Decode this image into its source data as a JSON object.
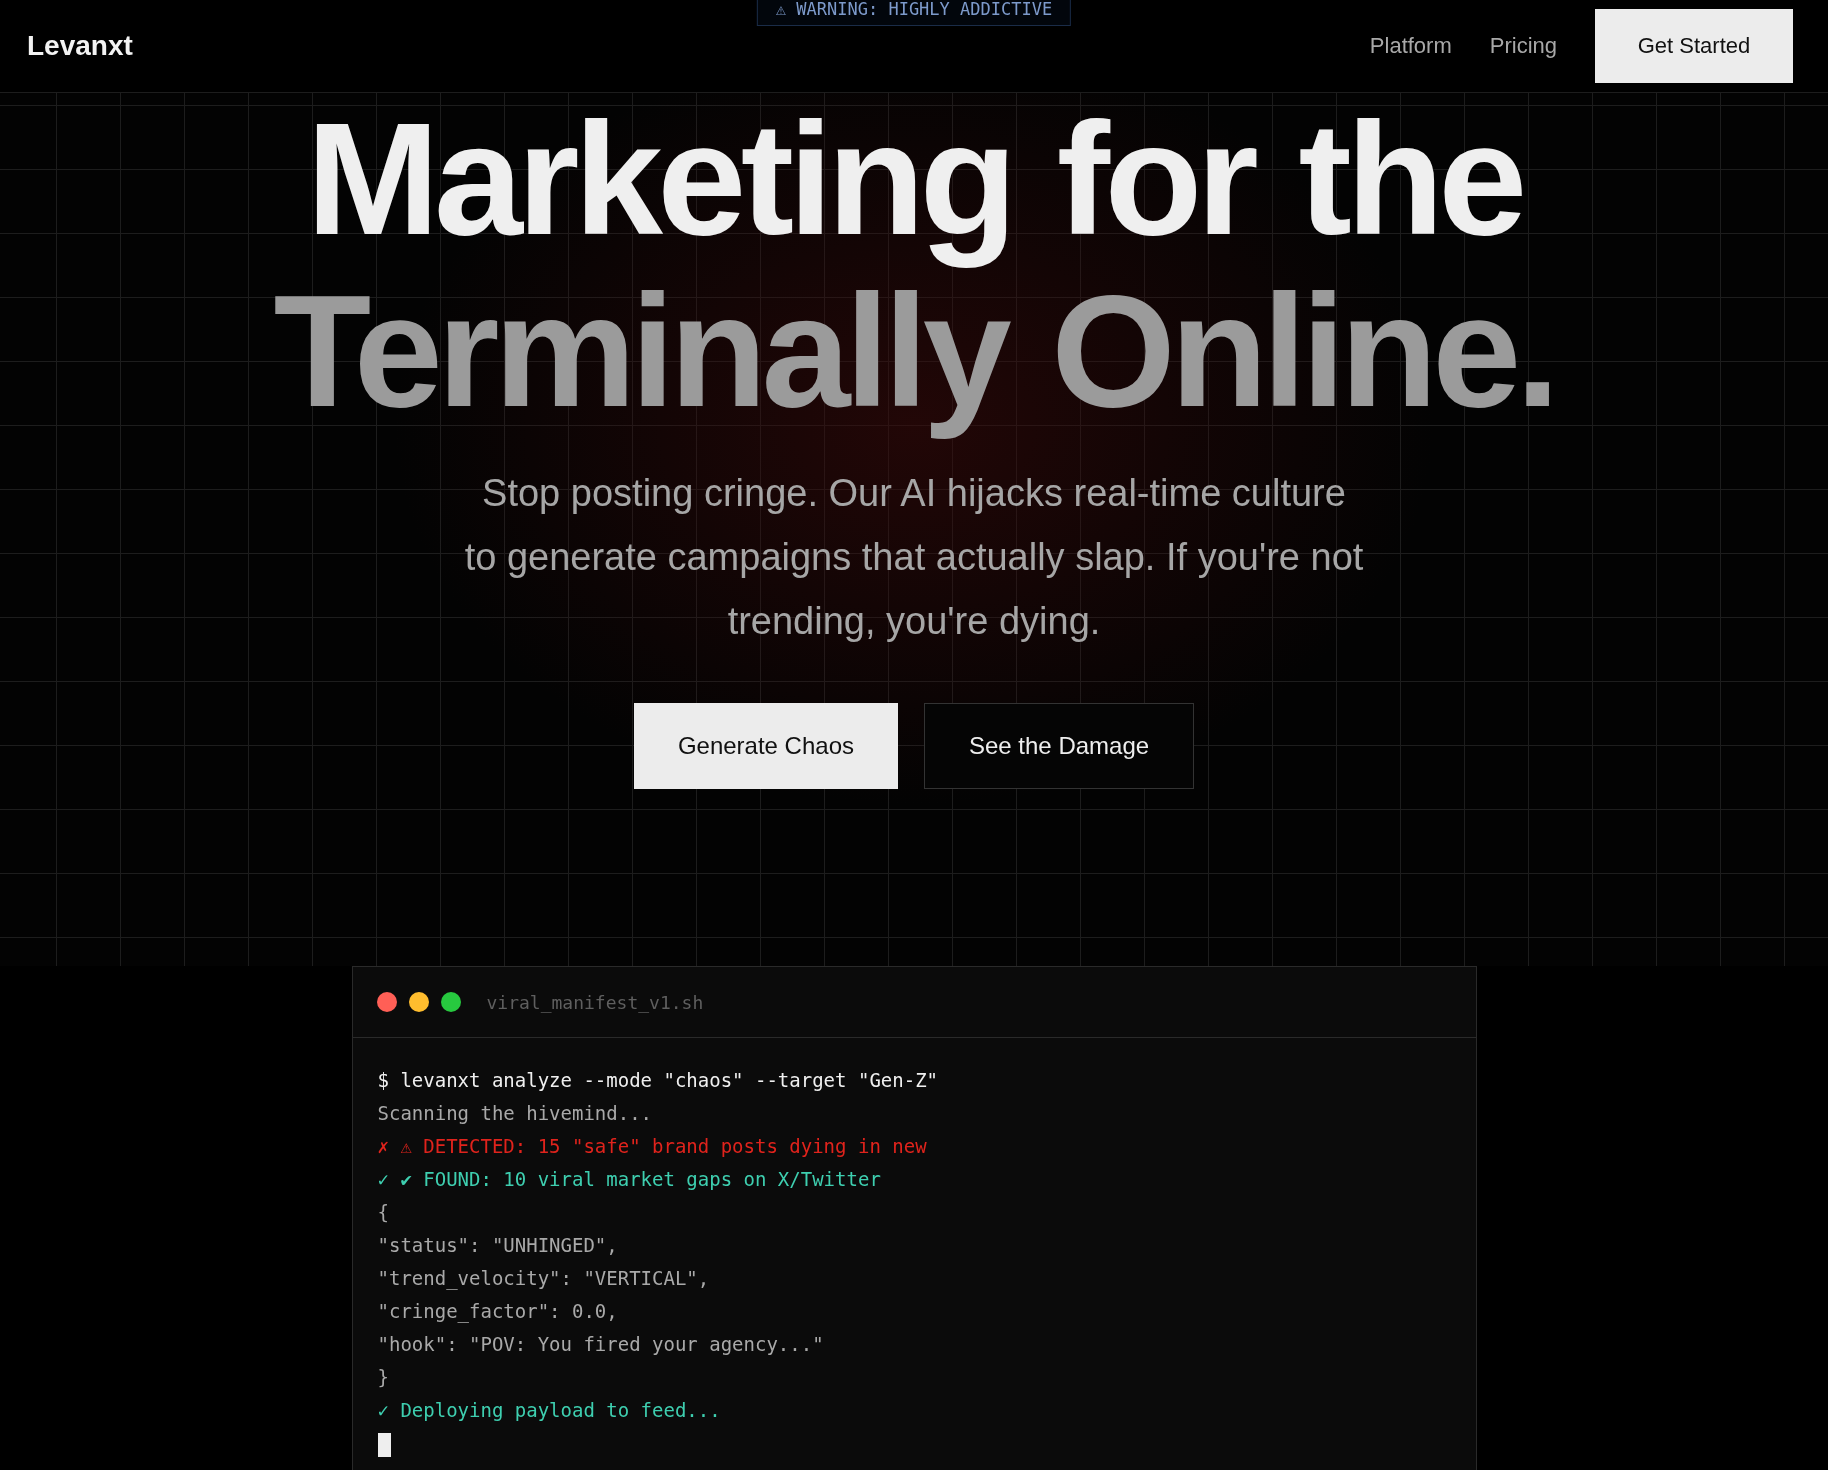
{
  "badge": "⚠ WARNING: HIGHLY ADDICTIVE",
  "nav": {
    "logo": "Levanxt",
    "links": [
      "Platform",
      "Pricing"
    ],
    "cta": "Get Started"
  },
  "hero": {
    "headline": [
      "Marketing for the",
      "Terminally Online."
    ],
    "subtitle": "Stop posting cringe. Our AI hijacks real-time culture to generate campaigns that actually slap. If you're not trending, you're dying.",
    "buttons": [
      {
        "kind": "primary",
        "label": "Generate Chaos"
      },
      {
        "kind": "outline",
        "label": "See the Damage"
      }
    ]
  },
  "terminal": {
    "filename": "viral_manifest_v1.sh",
    "cursor": true,
    "lines": [
      {
        "kind": "command",
        "text": "$ levanxt analyze --mode \"chaos\" --target \"Gen-Z\""
      },
      {
        "kind": "muted",
        "text": "Scanning the hivemind..."
      },
      {
        "kind": "error",
        "text": "✗ ⚠ DETECTED: 15 \"safe\" brand posts dying in new"
      },
      {
        "kind": "success",
        "text": "✓ ✔ FOUND: 10 viral market gaps on X/Twitter"
      },
      {
        "kind": "muted",
        "text": "{"
      },
      {
        "kind": "muted",
        "text": "\"status\": \"UNHINGED\","
      },
      {
        "kind": "muted",
        "text": "\"trend_velocity\": \"VERTICAL\","
      },
      {
        "kind": "muted",
        "text": "\"cringe_factor\": 0.0,"
      },
      {
        "kind": "muted",
        "text": "\"hook\": \"POV: You fired your agency...\""
      },
      {
        "kind": "muted",
        "text": "}"
      },
      {
        "kind": "success",
        "text": "✓ Deploying payload to feed..."
      }
    ]
  }
}
